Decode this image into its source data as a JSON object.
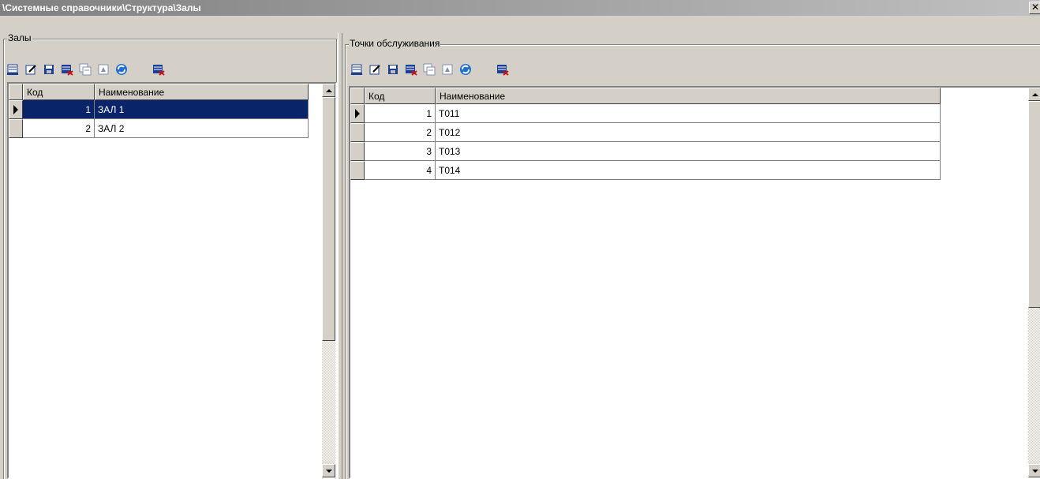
{
  "window": {
    "title": "\\Системные справочники\\Структура\\Залы",
    "close_glyph": "✕"
  },
  "left": {
    "group_caption": "Залы",
    "toolbar": [
      {
        "name": "add-record-icon"
      },
      {
        "name": "edit-record-icon"
      },
      {
        "name": "save-record-icon"
      },
      {
        "name": "delete-record-icon"
      },
      {
        "name": "copy-record-icon"
      },
      {
        "name": "move-record-icon"
      },
      {
        "name": "refresh-icon"
      },
      {
        "name": "close-record-icon"
      }
    ],
    "columns": [
      "Код",
      "Наименование"
    ],
    "rows": [
      {
        "code": "1",
        "name": "ЗАЛ 1",
        "selected": true
      },
      {
        "code": "2",
        "name": "ЗАЛ 2",
        "selected": false
      }
    ]
  },
  "right": {
    "group_caption": "Точки обслуживания",
    "toolbar": [
      {
        "name": "add-record-icon"
      },
      {
        "name": "edit-record-icon"
      },
      {
        "name": "save-record-icon"
      },
      {
        "name": "delete-record-icon"
      },
      {
        "name": "copy-record-icon"
      },
      {
        "name": "move-record-icon"
      },
      {
        "name": "refresh-icon"
      },
      {
        "name": "close-record-icon"
      }
    ],
    "columns": [
      "Код",
      "Наименование"
    ],
    "rows": [
      {
        "code": "1",
        "name": "Т011",
        "selected": false,
        "current": true
      },
      {
        "code": "2",
        "name": "Т012",
        "selected": false
      },
      {
        "code": "3",
        "name": "Т013",
        "selected": false
      },
      {
        "code": "4",
        "name": "Т014",
        "selected": false
      }
    ]
  },
  "colors": {
    "selection": "#0a246a",
    "face": "#d4d0c8",
    "icon_blue": "#1c3f94",
    "icon_red": "#d01010"
  }
}
